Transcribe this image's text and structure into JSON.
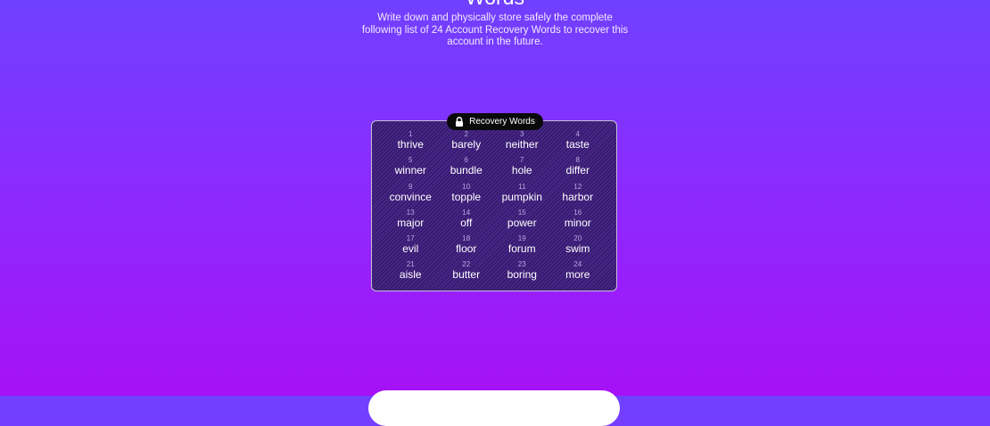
{
  "header": {
    "title": "Words",
    "description": "Write down and physically store safely the complete following list of 24 Account Recovery Words to recover this account in the future."
  },
  "badge": {
    "label": "Recovery Words",
    "icon": "lock-icon"
  },
  "words": [
    {
      "num": "1",
      "word": "thrive"
    },
    {
      "num": "2",
      "word": "barely"
    },
    {
      "num": "3",
      "word": "neither"
    },
    {
      "num": "4",
      "word": "taste"
    },
    {
      "num": "5",
      "word": "winner"
    },
    {
      "num": "6",
      "word": "bundle"
    },
    {
      "num": "7",
      "word": "hole"
    },
    {
      "num": "8",
      "word": "differ"
    },
    {
      "num": "9",
      "word": "convince"
    },
    {
      "num": "10",
      "word": "topple"
    },
    {
      "num": "11",
      "word": "pumpkin"
    },
    {
      "num": "12",
      "word": "harbor"
    },
    {
      "num": "13",
      "word": "major"
    },
    {
      "num": "14",
      "word": "off"
    },
    {
      "num": "15",
      "word": "power"
    },
    {
      "num": "16",
      "word": "minor"
    },
    {
      "num": "17",
      "word": "evil"
    },
    {
      "num": "18",
      "word": "floor"
    },
    {
      "num": "19",
      "word": "forum"
    },
    {
      "num": "20",
      "word": "swim"
    },
    {
      "num": "21",
      "word": "aisle"
    },
    {
      "num": "22",
      "word": "butter"
    },
    {
      "num": "23",
      "word": "boring"
    },
    {
      "num": "24",
      "word": "more"
    }
  ],
  "colors": {
    "gradient_top": "#7040ff",
    "gradient_bottom": "#a611f7",
    "card": "#3c1a7e",
    "badge": "#0a0a0a"
  }
}
